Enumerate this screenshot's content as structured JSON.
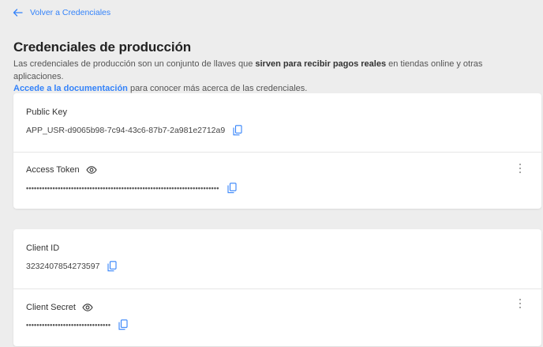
{
  "nav": {
    "back_label": "Volver a Credenciales"
  },
  "page": {
    "title": "Credenciales de producción",
    "desc_part1": "Las credenciales de producción son un conjunto de llaves que ",
    "desc_bold": "sirven para recibir pagos reales",
    "desc_part2": " en tiendas online y otras aplicaciones.",
    "doc_link": "Accede a la documentación",
    "desc_part3": " para conocer más acerca de las credenciales."
  },
  "credentials": {
    "public_key": {
      "label": "Public Key",
      "value": "APP_USR-d9065b98-7c94-43c6-87b7-2a981e2712a9"
    },
    "access_token": {
      "label": "Access Token",
      "value": "•••••••••••••••••••••••••••••••••••••••••••••••••••••••••••••••••••••••••"
    },
    "client_id": {
      "label": "Client ID",
      "value": "3232407854273597"
    },
    "client_secret": {
      "label": "Client Secret",
      "value": "••••••••••••••••••••••••••••••••"
    }
  },
  "icons": {
    "back": "arrow-left-icon",
    "copy": "copy-icon",
    "eye": "eye-icon",
    "more": "kebab-menu-icon"
  },
  "colors": {
    "accent": "#3483fa",
    "background": "#ededed",
    "card": "#ffffff"
  }
}
